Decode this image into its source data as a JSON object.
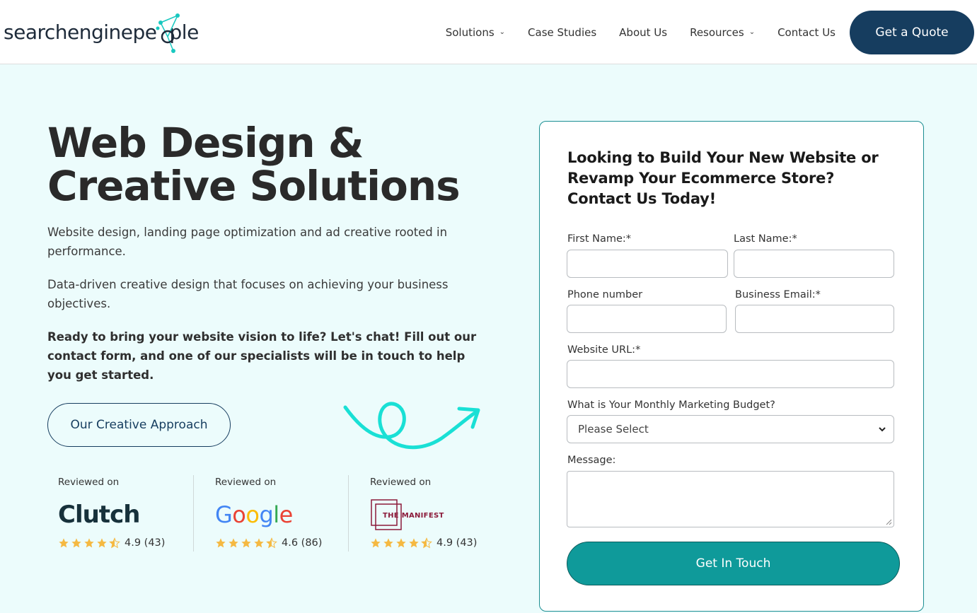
{
  "brand": {
    "logo_text_a": "searchenginepe",
    "logo_text_b": "ple",
    "logo_alt": "searchenginepeople"
  },
  "nav": {
    "items": [
      {
        "label": "Solutions",
        "has_dropdown": true
      },
      {
        "label": "Case Studies",
        "has_dropdown": false
      },
      {
        "label": "About Us",
        "has_dropdown": false
      },
      {
        "label": "Resources",
        "has_dropdown": true
      },
      {
        "label": "Contact Us",
        "has_dropdown": false
      }
    ],
    "cta_label": "Get a Quote"
  },
  "hero": {
    "title_line1": "Web Design &",
    "title_line2": "Creative Solutions",
    "para1": "Website design, landing page optimization and ad creative rooted in performance.",
    "para2": "Data-driven creative design that focuses on achieving your business objectives.",
    "para3": "Ready to bring your website vision to life? Let's chat! Fill out our contact form, and one of our specialists will be in touch to help you get started.",
    "button_label": "Our Creative Approach"
  },
  "reviews": [
    {
      "label": "Reviewed on",
      "platform": "Clutch",
      "rating_text": "4.9 (43)",
      "rating": 4.9,
      "count": 43
    },
    {
      "label": "Reviewed on",
      "platform": "Google",
      "rating_text": "4.6 (86)",
      "rating": 4.6,
      "count": 86
    },
    {
      "label": "Reviewed on",
      "platform": "THE MANIFEST",
      "rating_text": "4.9 (43)",
      "rating": 4.9,
      "count": 43
    }
  ],
  "form": {
    "title": "Looking to Build Your New Website or Revamp Your Ecommerce Store? Contact Us Today!",
    "first_name_label": "First Name:*",
    "last_name_label": "Last Name:*",
    "phone_label": "Phone number",
    "email_label": "Business Email:*",
    "website_label": "Website URL:*",
    "budget_label": "What is Your Monthly Marketing Budget?",
    "budget_value": "Please Select",
    "message_label": "Message:",
    "submit_label": "Get In Touch"
  },
  "colors": {
    "navy": "#163d5f",
    "teal": "#0f9a9a",
    "accent_cyan": "#19e0d5",
    "background": "#ecfcfc",
    "star": "#f5b942"
  }
}
